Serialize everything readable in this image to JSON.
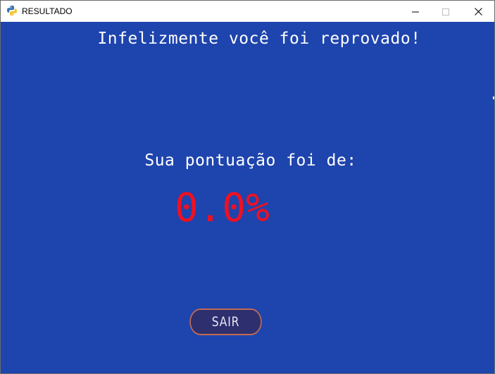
{
  "window": {
    "title": "RESULTADO",
    "controls": [
      "minimize",
      "maximize",
      "close"
    ]
  },
  "content": {
    "heading": "Infelizmente você foi reprovado!",
    "score_label": "Sua pontuação foi de:",
    "score_value": "0.0%",
    "exit_button_label": "SAIR"
  },
  "colors": {
    "background": "#1e44ad",
    "text": "#ffffff",
    "score": "#ee1122",
    "button_fill": "#2e2f6f",
    "button_border": "#c06a55"
  },
  "icons": {
    "app": "python-icon",
    "minimize": "minimize-icon",
    "maximize": "maximize-icon",
    "close": "close-icon"
  }
}
